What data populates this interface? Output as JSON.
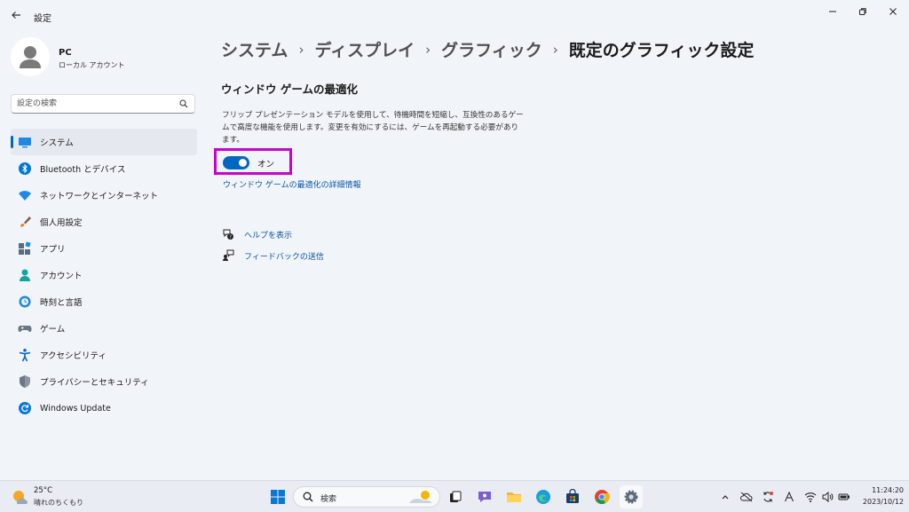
{
  "window": {
    "title": "設定"
  },
  "profile": {
    "name": "PC",
    "account_type": "ローカル アカウント"
  },
  "search": {
    "placeholder": "設定の検索"
  },
  "sidebar": {
    "items": [
      {
        "label": "システム",
        "icon": "system-icon",
        "active": true
      },
      {
        "label": "Bluetooth とデバイス",
        "icon": "bluetooth-icon"
      },
      {
        "label": "ネットワークとインターネット",
        "icon": "wifi-icon"
      },
      {
        "label": "個人用設定",
        "icon": "brush-icon"
      },
      {
        "label": "アプリ",
        "icon": "apps-icon"
      },
      {
        "label": "アカウント",
        "icon": "person-icon"
      },
      {
        "label": "時刻と言語",
        "icon": "globe-clock-icon"
      },
      {
        "label": "ゲーム",
        "icon": "gamepad-icon"
      },
      {
        "label": "アクセシビリティ",
        "icon": "accessibility-icon"
      },
      {
        "label": "プライバシーとセキュリティ",
        "icon": "shield-icon"
      },
      {
        "label": "Windows Update",
        "icon": "update-icon"
      }
    ]
  },
  "breadcrumb": [
    "システム",
    "ディスプレイ",
    "グラフィック",
    "既定のグラフィック設定"
  ],
  "section": {
    "title": "ウィンドウ ゲームの最適化",
    "description": "フリップ プレゼンテーション モデルを使用して、待機時間を短縮し、互換性のあるゲームで高度な機能を使用します。変更を有効にするには、ゲームを再起動する必要があります。",
    "toggle_state": "オン",
    "toggle_on": true,
    "details_link": "ウィンドウ ゲームの最適化の詳細情報"
  },
  "help": {
    "get_help": "ヘルプを表示",
    "feedback": "フィードバックの送信"
  },
  "taskbar": {
    "temperature": "25°C",
    "condition": "晴れのちくもり",
    "search_label": "検索",
    "time": "11:24:20",
    "date": "2023/10/12"
  },
  "colors": {
    "accent": "#0067c0",
    "highlight": "#cc00cc",
    "link": "#0b56a6"
  }
}
